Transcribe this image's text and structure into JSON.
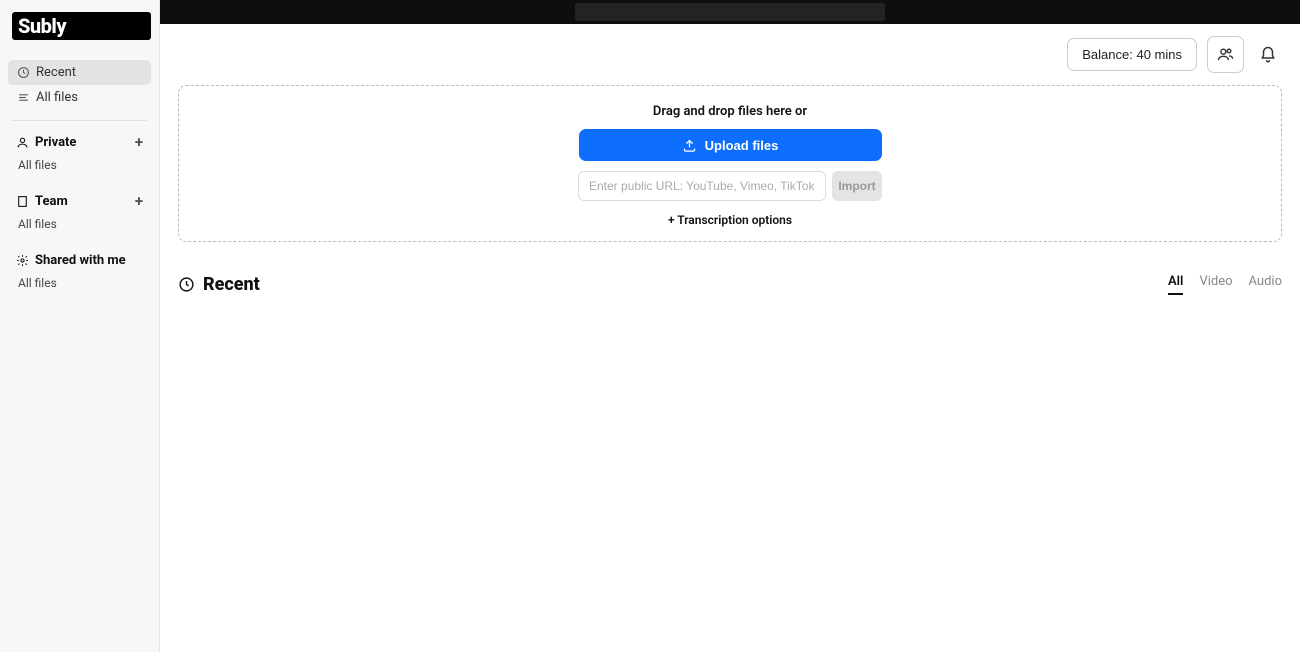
{
  "brand": "Subly",
  "sidebar": {
    "recent": "Recent",
    "allfiles": "All files",
    "private": {
      "label": "Private",
      "all": "All files"
    },
    "team": {
      "label": "Team",
      "all": "All files"
    },
    "shared": {
      "label": "Shared with me",
      "all": "All files"
    }
  },
  "header": {
    "balance": "Balance: 40 mins"
  },
  "dropzone": {
    "drag_text": "Drag and drop files here or",
    "upload_button": "Upload files",
    "url_placeholder": "Enter public URL: YouTube, Vimeo, TikTok...",
    "import_button": "Import",
    "transcription_options": "+ Transcription options"
  },
  "recent": {
    "title": "Recent",
    "filters": {
      "all": "All",
      "video": "Video",
      "audio": "Audio"
    }
  }
}
